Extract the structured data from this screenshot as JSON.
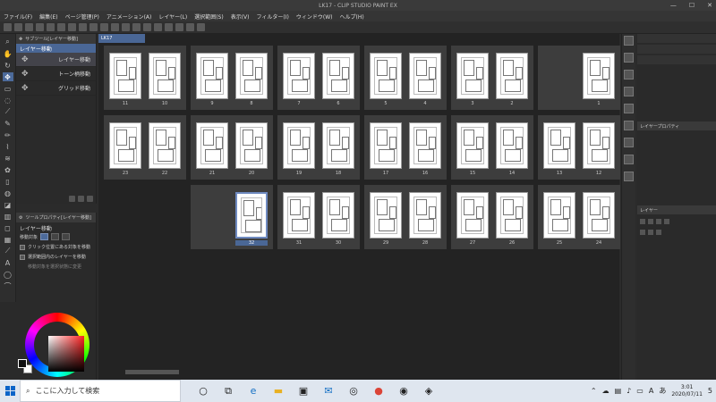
{
  "window": {
    "title": "LK17 - CLIP STUDIO PAINT EX"
  },
  "menubar": [
    "ファイル(F)",
    "編集(E)",
    "ページ管理(P)",
    "アニメーション(A)",
    "レイヤー(L)",
    "選択範囲(S)",
    "表示(V)",
    "フィルター(I)",
    "ウィンドウ(W)",
    "ヘルプ(H)"
  ],
  "subtool": {
    "tab_label": "サブツール[レイヤー移動]",
    "group_label": "レイヤー移動",
    "items": [
      "レイヤー移動",
      "トーン柄移動",
      "グリッド移動"
    ]
  },
  "toolprop": {
    "tab_label": "ツールプロパティ[レイヤー移動]",
    "title": "レイヤー移動",
    "target_label": "移動対象",
    "options": [
      "クリック位置にある対象を移動",
      "選択範囲内のレイヤーを移動",
      "移動対象を選択状態に変更"
    ]
  },
  "document": {
    "tab_label": "LK17",
    "rows": [
      [
        {
          "left": "11",
          "right": "10"
        },
        {
          "left": "9",
          "right": "8"
        },
        {
          "left": "7",
          "right": "6"
        },
        {
          "left": "5",
          "right": "4"
        },
        {
          "left": "3",
          "right": "2"
        },
        {
          "left": "",
          "right": "1"
        }
      ],
      [
        {
          "left": "23",
          "right": "22"
        },
        {
          "left": "21",
          "right": "20"
        },
        {
          "left": "19",
          "right": "18"
        },
        {
          "left": "17",
          "right": "16"
        },
        {
          "left": "15",
          "right": "14"
        },
        {
          "left": "13",
          "right": "12"
        }
      ],
      [
        {
          "left": "",
          "right": "32"
        },
        {
          "left": "31",
          "right": "30"
        },
        {
          "left": "29",
          "right": "28"
        },
        {
          "left": "27",
          "right": "26"
        },
        {
          "left": "25",
          "right": "24"
        }
      ]
    ]
  },
  "layer_panel": {
    "tab_label": "レイヤー",
    "layer_label": "レイヤープロパティ"
  },
  "taskbar": {
    "search_placeholder": "ここに入力して検索",
    "time": "3:01",
    "date": "2020/07/11",
    "notifications": "5"
  }
}
